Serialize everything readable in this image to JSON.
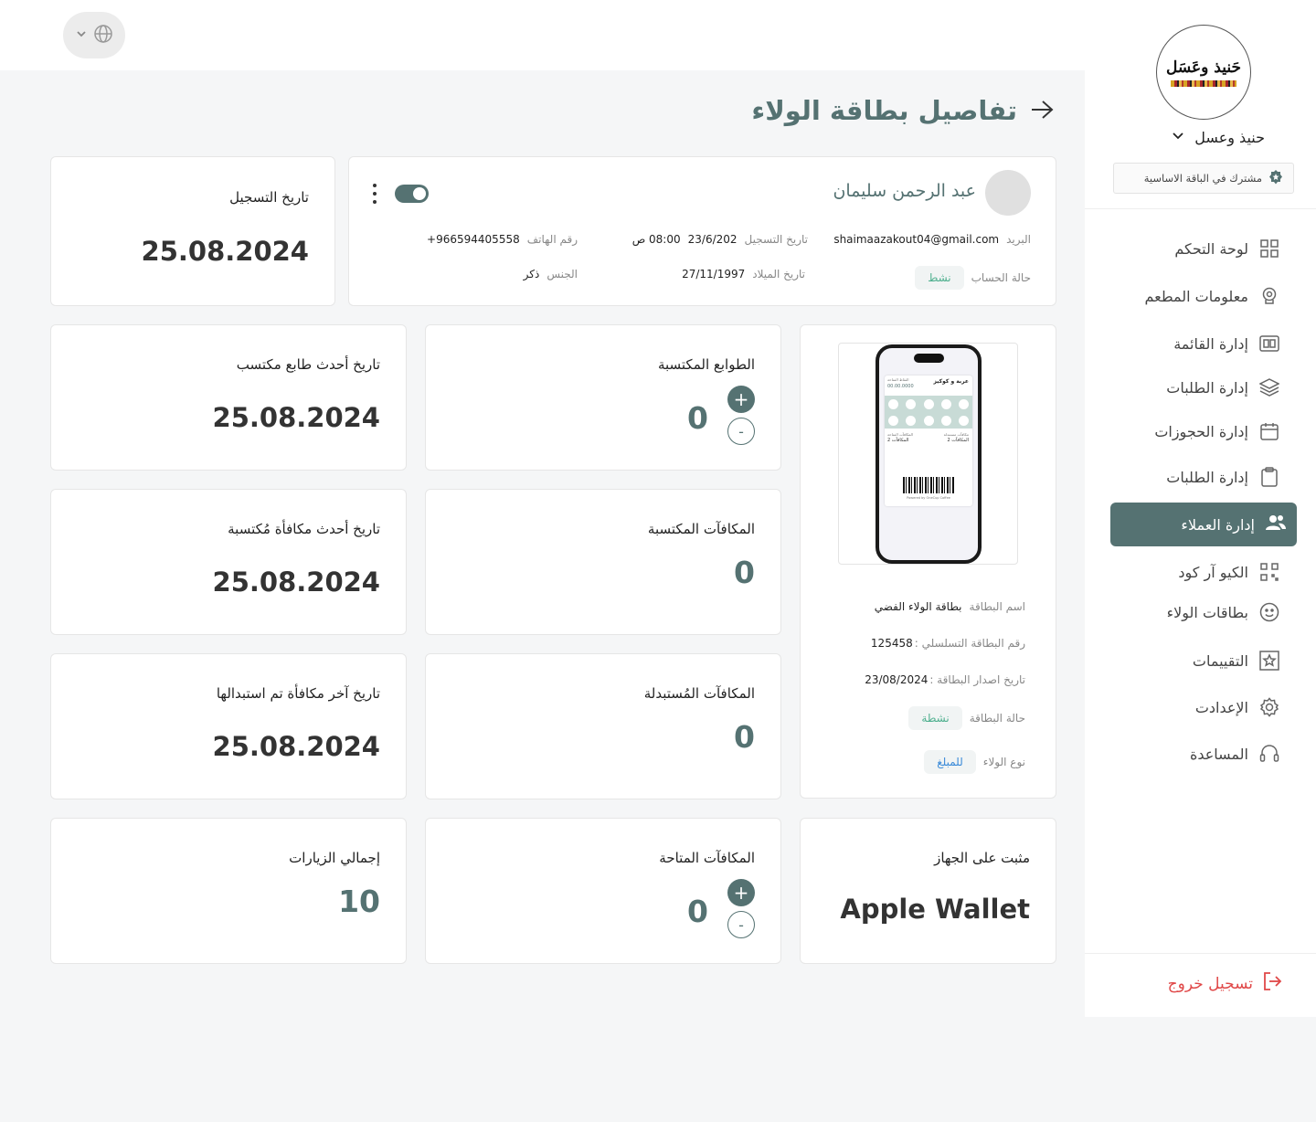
{
  "topbar": {
    "lang_icon": "globe-icon"
  },
  "sidebar": {
    "logo_text": "حَنيذ وعَسَل",
    "brand_name": "حنيذ وعسل",
    "plan": "مشترك في الباقة الاساسية",
    "nav": [
      {
        "label": "لوحة التحكم",
        "icon": "dashboard-grid-icon"
      },
      {
        "label": "معلومات المطعم",
        "icon": "chef-hat-icon"
      },
      {
        "label": "إدارة القائمة",
        "icon": "menu-card-icon"
      },
      {
        "label": "إدارة الطلبات",
        "icon": "layers-icon"
      },
      {
        "label": "إدارة الحجوزات",
        "icon": "calendar-icon"
      },
      {
        "label": "إدارة الطلبات",
        "icon": "clipboard-icon"
      },
      {
        "label": "إدارة العملاء",
        "icon": "users-icon",
        "active": true
      },
      {
        "label": "الكيو آر كود",
        "icon": "qr-code-icon"
      },
      {
        "label": "بطاقات الولاء",
        "icon": "smile-icon"
      },
      {
        "label": "التقييمات",
        "icon": "star-frame-icon"
      },
      {
        "label": "الإعدادت",
        "icon": "gear-icon"
      },
      {
        "label": "المساعدة",
        "icon": "headset-icon"
      }
    ],
    "logout": "تسجيل خروج"
  },
  "page": {
    "title": "تفاصيل بطاقة الولاء"
  },
  "customer": {
    "name": "عبد الرحمن سليمان",
    "email_label": "البريد",
    "email": "shaimaazakout04@gmail.com",
    "reg_label": "تاريخ التسجيل",
    "reg_date": "23/6/202",
    "reg_time": "08:00 ص",
    "phone_label": "رقم الهاتف",
    "phone": "+966594405558",
    "status_label": "حالة الحساب",
    "status": "نشط",
    "birth_label": "تاريخ الميلاد",
    "birth": "27/11/1997",
    "gender_label": "الجنس",
    "gender": "ذكر"
  },
  "registration": {
    "label": "تاريخ التسجيل",
    "value": "25.08.2024"
  },
  "card_info": {
    "name_label": "اسم البطاقة",
    "name": "بطاقة الولاء الفضي",
    "serial_label": "رقم البطاقة التسلسلي :",
    "serial": "125458",
    "issue_label": "تاريخ اصدار البطاقة :",
    "issue": "23/08/2024",
    "status_label": "حالة البطاقة",
    "status": "نشطة",
    "type_label": "نوع الولاء",
    "type": "للمبلغ",
    "preview": {
      "shop_name": "عربة و كوكيز",
      "balance_label": "النقاط المتاحة",
      "balance": "00.00.0000",
      "left_label": "المكافآت المتاحة",
      "left_value": "المكافآت 2",
      "right_label": "مكافآت مستبدلة",
      "right_value": "المكافآت 2",
      "footer": "Powered by OneCup Coffee"
    }
  },
  "stats": {
    "stamps_earned": {
      "label": "الطوابع المكتسبة",
      "value": "0"
    },
    "rewards_earned": {
      "label": "المكافآت المكتسبة",
      "value": "0"
    },
    "rewards_redeemed": {
      "label": "المكافآت المُستبدلة",
      "value": "0"
    },
    "rewards_available": {
      "label": "المكافآت المتاحة",
      "value": "0"
    },
    "last_stamp": {
      "label": "تاريخ أحدث طابع مكتسب",
      "value": "25.08.2024"
    },
    "last_reward": {
      "label": "تاريخ أحدث مكافأة مُكتسبة",
      "value": "25.08.2024"
    },
    "last_redeemed": {
      "label": "تاريخ آخر مكافأة تم استبدالها",
      "value": "25.08.2024"
    },
    "total_visits": {
      "label": "إجمالي الزيارات",
      "value": "10"
    },
    "device": {
      "label": "مثبت على الجهاز",
      "value": "Apple Wallet"
    }
  },
  "colors": {
    "accent": "#557272",
    "danger": "#e04848",
    "link": "#3a8ad8"
  }
}
